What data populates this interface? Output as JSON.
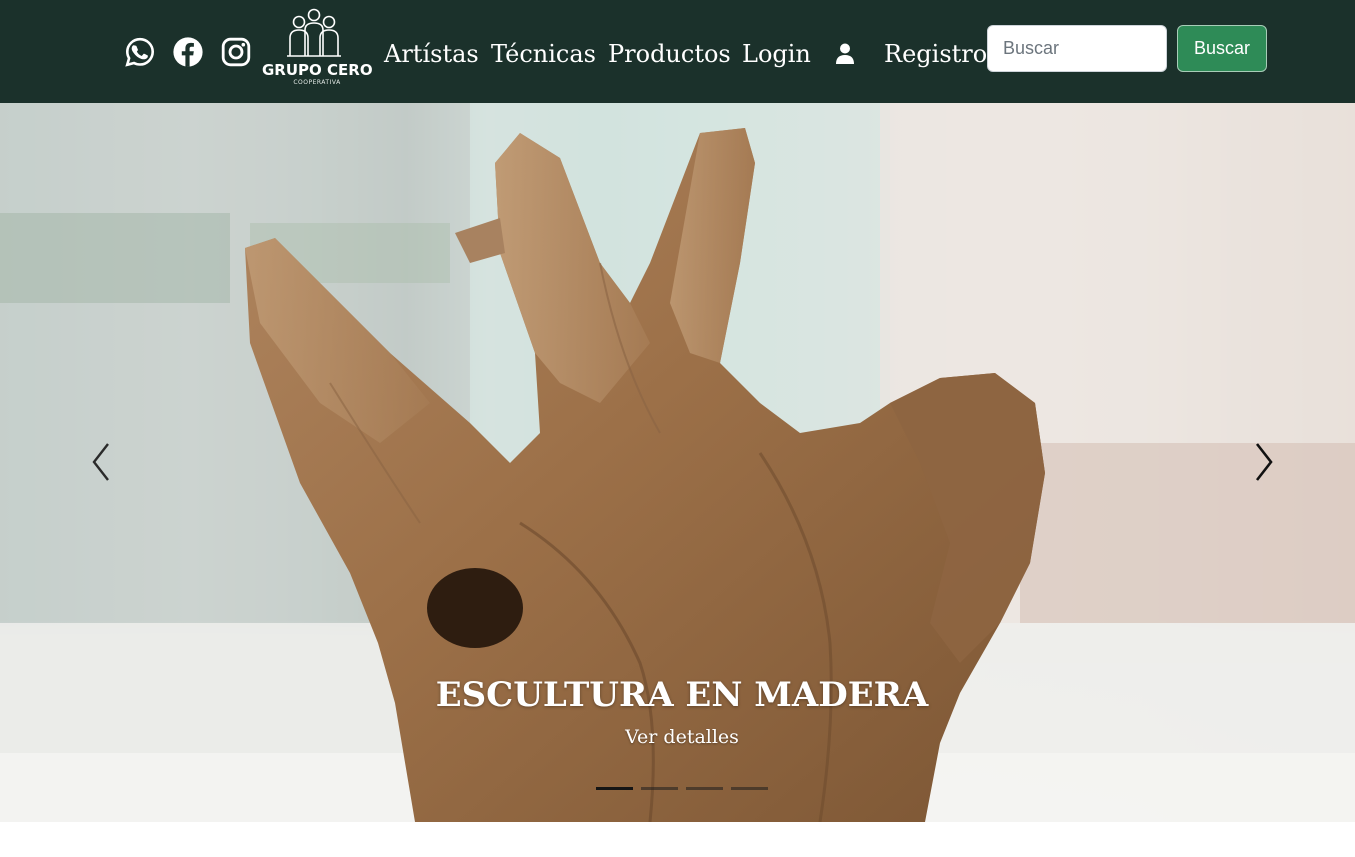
{
  "header": {
    "social": [
      {
        "icon": "whatsapp-icon"
      },
      {
        "icon": "facebook-icon"
      },
      {
        "icon": "instagram-icon"
      }
    ],
    "logo": {
      "name": "GRUPO CERO",
      "subtitle": "COOPERATIVA"
    },
    "nav": {
      "artists": "Artístas",
      "techniques": "Técnicas",
      "products": "Productos",
      "login": "Login",
      "register": "Registro"
    },
    "search": {
      "placeholder": "Buscar",
      "button_label": "Buscar"
    }
  },
  "carousel": {
    "slide_title": "ESCULTURA EN MADERA",
    "slide_link": "Ver detalles",
    "slide_count": 4,
    "active_slide": 1
  },
  "colors": {
    "navbar": "#1b312b",
    "search_button": "#2e8b57",
    "text": "#ffffff"
  }
}
